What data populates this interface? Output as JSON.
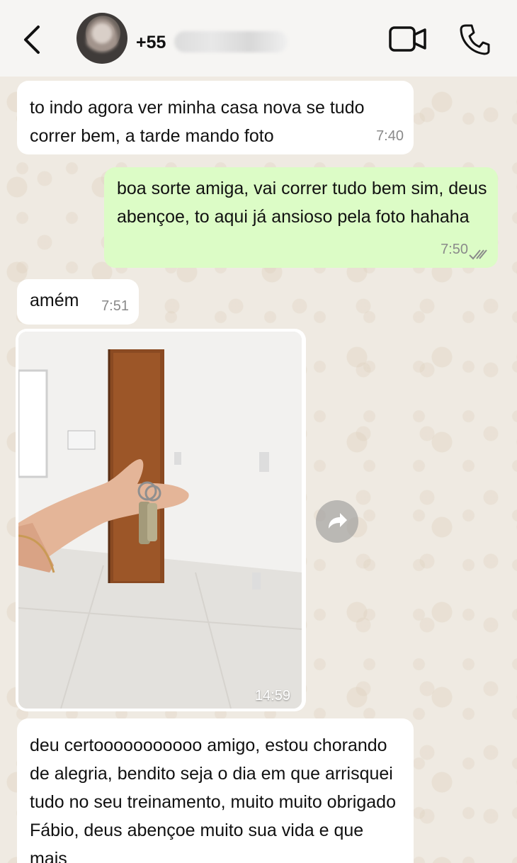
{
  "header": {
    "contact_name": "+55",
    "back_icon": "chevron-left-icon",
    "video_icon": "video-camera-icon",
    "call_icon": "phone-icon"
  },
  "messages": [
    {
      "direction": "incoming",
      "text": "to indo agora ver minha casa nova se tudo correr bem, a tarde mando foto",
      "time": "7:40"
    },
    {
      "direction": "outgoing",
      "text": "boa sorte amiga, vai correr tudo bem sim, deus abençoe, to aqui já ansioso pela foto hahaha",
      "time": "7:50",
      "status": "read"
    },
    {
      "direction": "incoming",
      "text": "amém",
      "time": "7:51"
    },
    {
      "direction": "incoming",
      "type": "image",
      "time": "14:59"
    },
    {
      "direction": "incoming",
      "text": "deu certooooooooooo amigo, estou chorando de alegria, bendito seja o dia em que arrisquei tudo no seu treinamento, muito muito obrigado Fábio, deus abençoe muito sua vida e que mais"
    }
  ],
  "colors": {
    "incoming_bubble": "#ffffff",
    "outgoing_bubble": "#dcfcc6",
    "chat_background": "#efeae2",
    "header_background": "#f6f5f3"
  }
}
